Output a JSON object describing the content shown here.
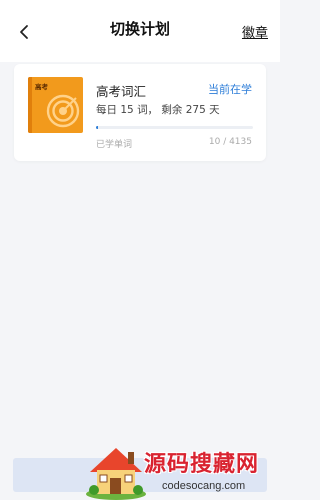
{
  "header": {
    "title": "切换计划",
    "badge_link": "徽章",
    "back_icon": "chevron-left-icon"
  },
  "plan_card": {
    "cover_label": "高考",
    "book_name": "高考词汇",
    "status": "当前在学",
    "daily_prefix": "每日",
    "daily_count": "15",
    "daily_unit": "词，",
    "remain_prefix": "剩余",
    "remain_days": "275",
    "remain_unit": "天",
    "learned_label": "已学单词",
    "learned_count": "10 / 4135",
    "progress_fraction": 0.0024,
    "accent_color": "#2e7ed8",
    "cover_color": "#f29a1c"
  },
  "watermark": {
    "cn": "源码搜藏网",
    "en": "codesocang.com"
  }
}
